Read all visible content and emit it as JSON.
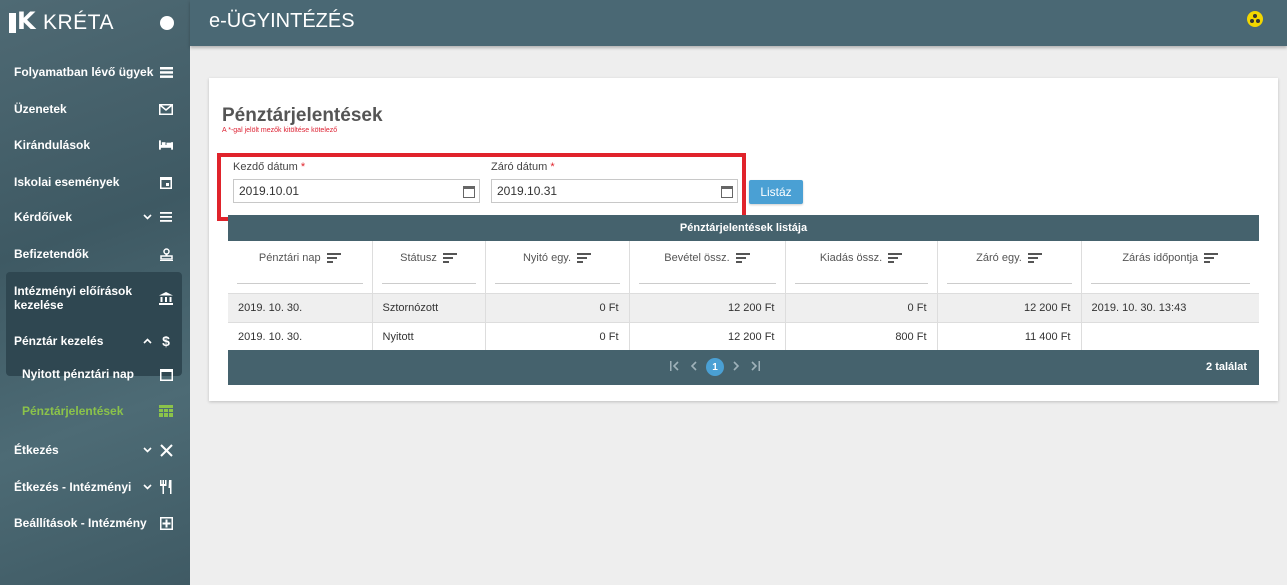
{
  "app": {
    "brand": "KRÉTA",
    "title": "e-ÜGYINTÉZÉS"
  },
  "sidebar": {
    "items": [
      {
        "label": "Folyamatban lévő ügyek",
        "icon": "list-icon"
      },
      {
        "label": "Üzenetek",
        "icon": "mail-icon"
      },
      {
        "label": "Kirándulások",
        "icon": "bed-icon"
      },
      {
        "label": "Iskolai események",
        "icon": "calendar-event-icon"
      },
      {
        "label": "Kérdőívek",
        "icon": "list-icon"
      },
      {
        "label": "Befizetendők",
        "icon": "stamp-icon"
      },
      {
        "label": "Intézményi előírások kezelése",
        "icon": "bank-icon"
      },
      {
        "label": "Pénztár kezelés",
        "icon": "dollar-icon"
      },
      {
        "label": "Nyitott pénztári nap",
        "icon": "calendar-icon"
      },
      {
        "label": "Pénztárjelentések",
        "icon": "table-icon"
      },
      {
        "label": "Étkezés",
        "icon": "utensils-cross-icon"
      },
      {
        "label": "Étkezés - Intézményi",
        "icon": "utensils-icon"
      },
      {
        "label": "Beállítások - Intézmény",
        "icon": "settings-box-icon"
      }
    ]
  },
  "page": {
    "title": "Pénztárjelentések",
    "required_note": "A *-gal jelölt mezők kitöltése kötelező",
    "start_label": "Kezdő dátum",
    "end_label": "Záró dátum",
    "required_mark": "*",
    "start_value": "2019.10.01",
    "end_value": "2019.10.31",
    "list_button": "Listáz"
  },
  "table": {
    "caption": "Pénztárjelentések listája",
    "columns": [
      "Pénztári nap",
      "Státusz",
      "Nyitó egy.",
      "Bevétel össz.",
      "Kiadás össz.",
      "Záró egy.",
      "Zárás időpontja"
    ],
    "rows": [
      [
        "2019. 10. 30.",
        "Sztornózott",
        "0 Ft",
        "12 200 Ft",
        "0 Ft",
        "12 200 Ft",
        "2019. 10. 30. 13:43"
      ],
      [
        "2019. 10. 30.",
        "Nyitott",
        "0 Ft",
        "12 200 Ft",
        "800 Ft",
        "11 400 Ft",
        ""
      ]
    ],
    "current_page": "1",
    "result_count": "2 találat"
  },
  "colors": {
    "sidebar": "#45626d",
    "topbar": "#4a6874",
    "accent": "#4aa0d4",
    "active_item": "#8bc34a",
    "highlight": "#e0232b",
    "user_badge": "#f2d600"
  }
}
